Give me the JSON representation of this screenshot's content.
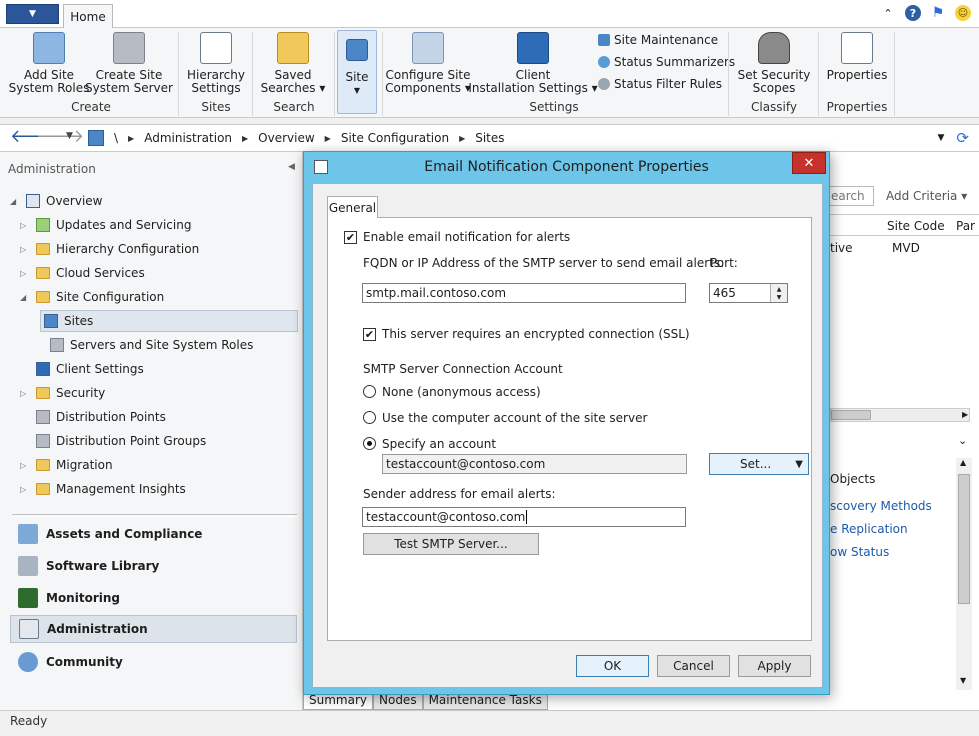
{
  "titlebar": {
    "home_tab": "Home"
  },
  "ribbon": {
    "add_site_roles": "Add Site\nSystem Roles",
    "create_site_server": "Create Site\nSystem Server",
    "group_create": "Create",
    "hierarchy_settings": "Hierarchy\nSettings",
    "group_sites": "Sites",
    "saved_searches": "Saved\nSearches ▾",
    "group_search": "Search",
    "site": "Site",
    "configure_site_components": "Configure Site\nComponents ▾",
    "client_installation_settings": "Client\nInstallation Settings ▾",
    "site_maintenance": "Site Maintenance",
    "status_summarizers": "Status Summarizers",
    "status_filter_rules": "Status Filter Rules",
    "group_settings": "Settings",
    "set_security_scopes": "Set Security\nScopes",
    "group_classify": "Classify",
    "properties": "Properties",
    "group_properties": "Properties"
  },
  "address_bar": {
    "root": "\\",
    "crumbs": [
      "Administration",
      "Overview",
      "Site Configuration",
      "Sites"
    ]
  },
  "left_pane": {
    "header": "Administration",
    "tree": [
      {
        "label": "Overview"
      },
      {
        "label": "Updates and Servicing"
      },
      {
        "label": "Hierarchy Configuration"
      },
      {
        "label": "Cloud Services"
      },
      {
        "label": "Site Configuration"
      },
      {
        "label": "Sites"
      },
      {
        "label": "Servers and Site System Roles"
      },
      {
        "label": "Client Settings"
      },
      {
        "label": "Security"
      },
      {
        "label": "Distribution Points"
      },
      {
        "label": "Distribution Point Groups"
      },
      {
        "label": "Migration"
      },
      {
        "label": "Management Insights"
      }
    ],
    "workspaces": [
      "Assets and Compliance",
      "Software Library",
      "Monitoring",
      "Administration",
      "Community"
    ]
  },
  "right_pane": {
    "search_placeholder": "earch",
    "add_criteria": "Add Criteria ▾",
    "col_site_code": "Site Code",
    "col_par": "Par",
    "row_status": "tive",
    "row_site_code": "MVD",
    "related_objects": "Objects",
    "link1": "scovery Methods",
    "link2": "e Replication",
    "link3": "ow Status",
    "bottom_tabs": [
      "Summary",
      "Nodes",
      "Maintenance Tasks"
    ]
  },
  "dialog": {
    "title": "Email Notification Component Properties",
    "close": "✕",
    "tab_general": "General",
    "enable_label": "Enable email notification for alerts",
    "fqdn_label": "FQDN or IP Address of the SMTP server to send email alerts:",
    "port_label": "Port:",
    "smtp_server": "smtp.mail.contoso.com",
    "port": "465",
    "ssl_label": "This server requires an encrypted connection (SSL)",
    "account_heading": "SMTP Server Connection Account",
    "radio_none": "None (anonymous access)",
    "radio_computer": "Use the computer account of the site server",
    "radio_specify": "Specify an account",
    "account_value": "testaccount@contoso.com",
    "set_button": "Set...",
    "sender_label": "Sender address for email alerts:",
    "sender_value": "testaccount@contoso.com",
    "test_button": "Test SMTP Server...",
    "ok": "OK",
    "cancel": "Cancel",
    "apply": "Apply"
  },
  "status": {
    "text": "Ready"
  }
}
